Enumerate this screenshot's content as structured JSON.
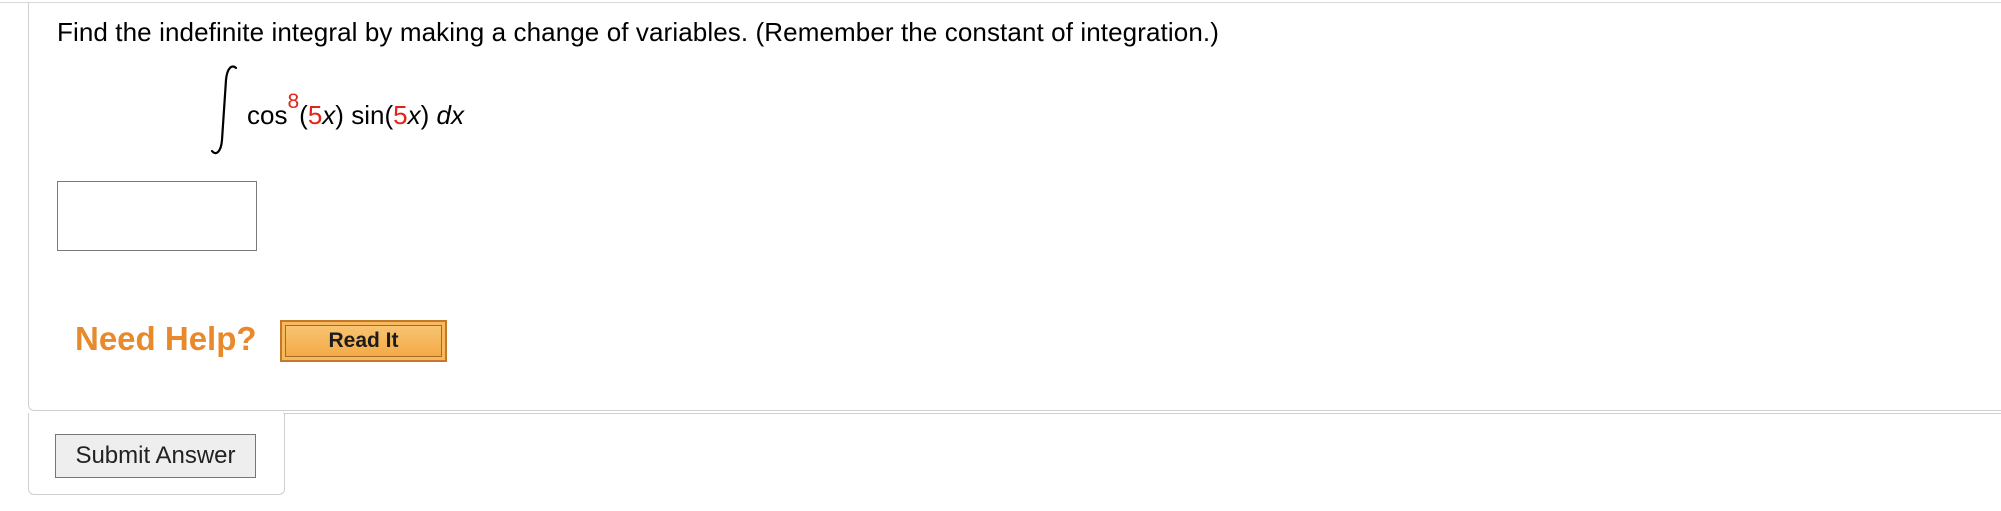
{
  "question": {
    "prompt": "Find the indefinite integral by making a change of variables. (Remember the constant of integration.)",
    "expression": {
      "func1": "cos",
      "exponent": "8",
      "arg1_open": "(",
      "arg1_coeff": "5",
      "arg1_var": "x",
      "arg1_close": ")",
      "func2": "sin",
      "arg2_open": "(",
      "arg2_coeff": "5",
      "arg2_var": "x",
      "arg2_close": ")",
      "differential": "dx"
    },
    "answer": {
      "value": "",
      "placeholder": ""
    }
  },
  "help": {
    "label": "Need Help?",
    "read_it_label": "Read It"
  },
  "submit": {
    "label": "Submit Answer"
  },
  "colors": {
    "accent_red": "#e2231a",
    "help_orange": "#e8892b",
    "read_it_fill": "#f6b95d"
  }
}
